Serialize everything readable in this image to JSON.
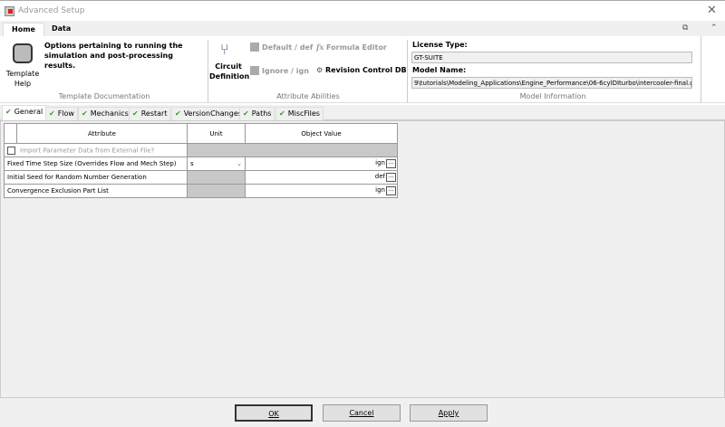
{
  "window": {
    "title": "Advanced Setup"
  },
  "ribbon": {
    "tabs": [
      {
        "label": "Home",
        "active": true
      },
      {
        "label": "Data",
        "active": false
      }
    ],
    "template_help_label_1": "Template",
    "template_help_label_2": "Help",
    "description": "Options pertaining to running the simulation and post-processing results.",
    "group_template_doc": "Template Documentation",
    "circuit_label_1": "Circuit",
    "circuit_label_2": "Definition",
    "default_def": "Default / def",
    "ignore_ign": "Ignore / ign",
    "formula_editor": "Formula Editor",
    "revision_control": "Revision Control DB",
    "group_attr": "Attribute Abilities",
    "license_label": "License Type:",
    "license_value": "GT-SUITE",
    "model_label": "Model Name:",
    "model_value": "9\\tutorials\\Modeling_Applications\\Engine_Performance\\06-6cylDIturbo\\intercooler-final.gtm",
    "group_model": "Model Information"
  },
  "tabs": [
    "General",
    "Flow",
    "Mechanics",
    "Restart",
    "VersionChanges",
    "Paths",
    "MiscFiles"
  ],
  "grid": {
    "headers": [
      "Attribute",
      "Unit",
      "Object Value"
    ],
    "import_row": "Import Parameter Data from External File?",
    "rows": [
      {
        "attribute": "Fixed Time Step Size (Overrides Flow and Mech Step)",
        "unit": "s",
        "value": "ign"
      },
      {
        "attribute": "Initial Seed for Random Number Generation",
        "unit": "",
        "value": "def"
      },
      {
        "attribute": "Convergence Exclusion Part List",
        "unit": "",
        "value": "ign"
      }
    ],
    "ellipsis": "..."
  },
  "footer": {
    "ok": "OK",
    "cancel": "Cancel",
    "apply": "Apply"
  }
}
